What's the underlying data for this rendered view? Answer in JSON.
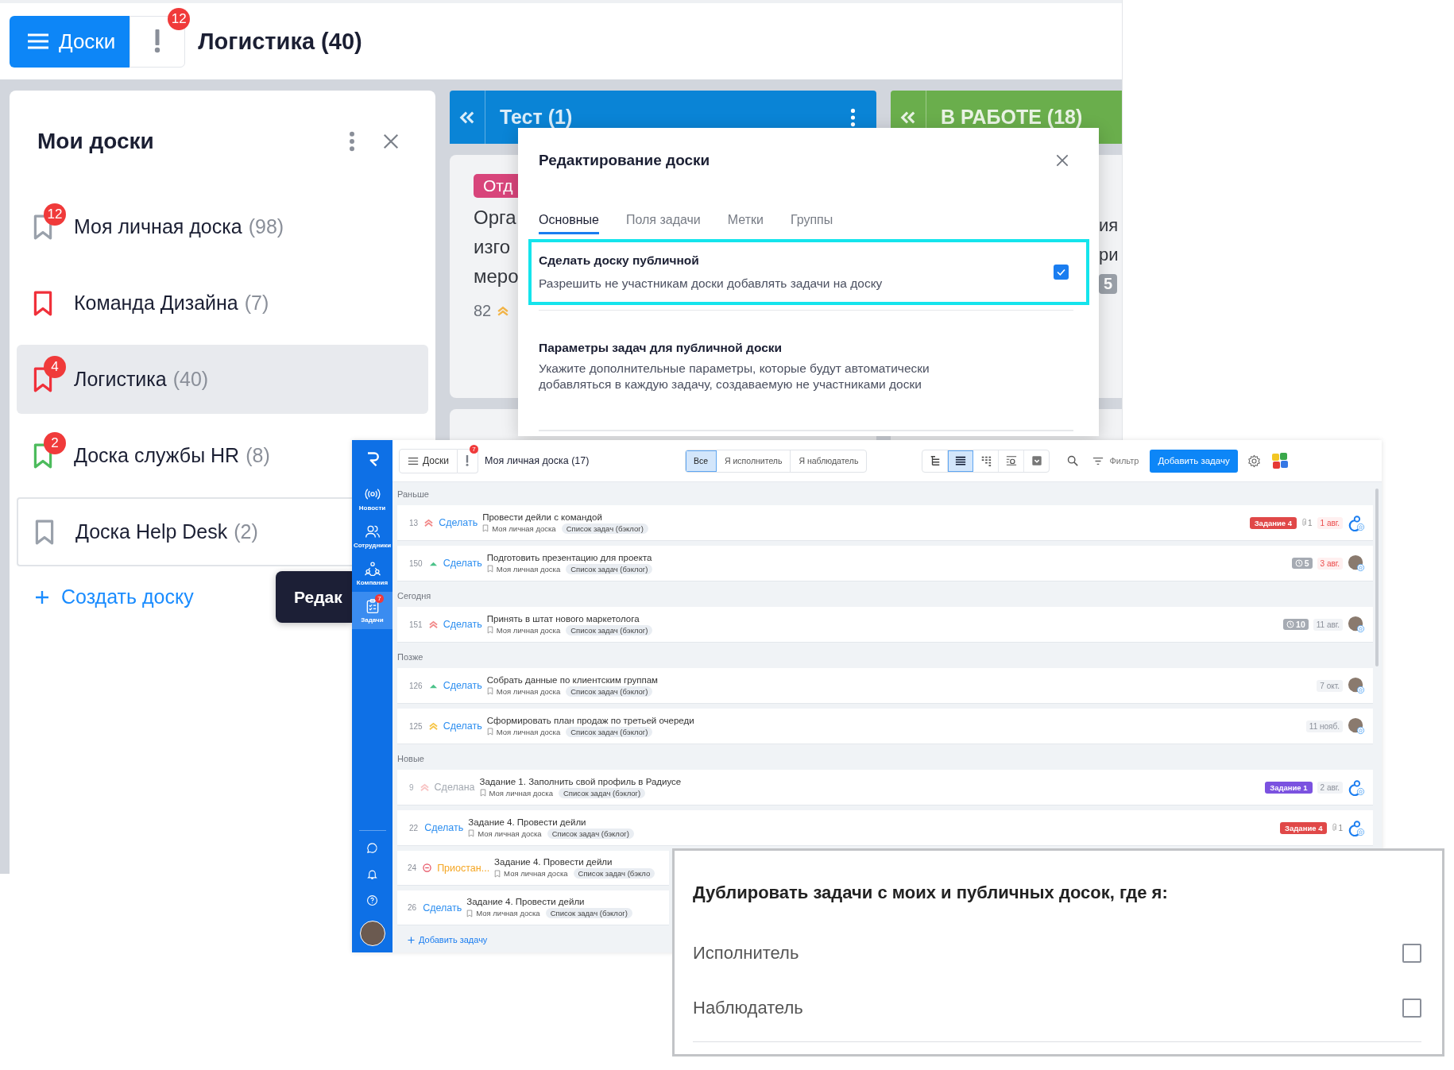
{
  "boards_app": {
    "menu_button": "Доски",
    "alerts_badge": "12",
    "title": "Логистика (40)",
    "sidebar": {
      "title": "Мои доски",
      "items": [
        {
          "name": "Моя личная доска",
          "count": "(98)",
          "color": "#9aa1ab",
          "badge": "12",
          "selected": false,
          "hovered": false
        },
        {
          "name": "Команда Дизайна",
          "count": "(7)",
          "color": "#f0303a",
          "selected": false,
          "hovered": false
        },
        {
          "name": "Логистика",
          "count": "(40)",
          "color": "#f0303a",
          "badge": "4",
          "selected": true,
          "hovered": false
        },
        {
          "name": "Доска службы HR",
          "count": "(8)",
          "color": "#4cbb5c",
          "badge": "2",
          "selected": false,
          "hovered": false
        },
        {
          "name": "Доска Help Desk",
          "count": "(2)",
          "color": "#9aa1ab",
          "selected": false,
          "hovered": true
        }
      ],
      "create_link": "Создать доску"
    },
    "tooltip": "Редак",
    "columns": [
      {
        "title": "Тест (1)",
        "color": "#0a84d6",
        "card": {
          "tag": "Отд",
          "lines": [
            "Орга",
            "изго",
            "меро"
          ],
          "number": "82"
        }
      },
      {
        "title": "В РАБОТЕ (18)",
        "color": "#6aae4c",
        "card": {
          "lines": [
            "ия",
            "ри"
          ],
          "timer": "5"
        }
      }
    ]
  },
  "edit_board_dialog": {
    "title": "Редактирование доски",
    "tabs": [
      {
        "label": "Основные",
        "selected": true
      },
      {
        "label": "Поля задачи",
        "selected": false
      },
      {
        "label": "Метки",
        "selected": false
      },
      {
        "label": "Группы",
        "selected": false
      }
    ],
    "public_setting": {
      "title": "Сделать доску публичной",
      "description": "Разрешить не участникам доски добавлять задачи на доску",
      "checked": true
    },
    "params": {
      "title": "Параметры задач для публичной доски",
      "description": "Укажите дополнительные параметры, которые будут автоматически добавляться в каждую задачу, создаваемую не участниками доски"
    }
  },
  "tasks_app": {
    "nav": [
      {
        "label": "Новости",
        "kind": "news",
        "selected": false
      },
      {
        "label": "Сотрудники",
        "kind": "people",
        "selected": false
      },
      {
        "label": "Компания",
        "kind": "company",
        "selected": false
      },
      {
        "label": "Задачи",
        "kind": "tasks",
        "selected": true,
        "badge": "7"
      }
    ],
    "menu_button": "Доски",
    "alerts_badge": "7",
    "title": "Моя личная доска (17)",
    "filter_tabs": [
      {
        "label": "Все",
        "selected": true
      },
      {
        "label": "Я исполнитель",
        "selected": false
      },
      {
        "label": "Я наблюдатель",
        "selected": false
      }
    ],
    "views": [
      {
        "kind": "tree",
        "selected": false
      },
      {
        "kind": "list",
        "selected": true
      },
      {
        "kind": "grid",
        "selected": false
      },
      {
        "kind": "timeline",
        "selected": false
      },
      {
        "kind": "archive",
        "selected": false
      }
    ],
    "filter_label": "Фильтр",
    "add_button": "Добавить задачу",
    "sections": [
      {
        "title": "Раньше",
        "tasks": [
          {
            "number": "13",
            "priority": {
              "kind": "high"
            },
            "status": {
              "kind": "todo",
              "label": "Сделать"
            },
            "title": "Провести дейли с командой",
            "board": "Моя личная доска",
            "list": "Список задач (бэклог)",
            "tag": {
              "label": "Задание 4",
              "color": "#e04848"
            },
            "attachments": "1",
            "date": {
              "label": "1 авг.",
              "overdue": true
            },
            "assignee": {
              "kind": "group"
            }
          },
          {
            "number": "150",
            "priority": {
              "kind": "low"
            },
            "status": {
              "kind": "todo",
              "label": "Сделать"
            },
            "title": "Подготовить презентацию для проекта",
            "board": "Моя личная доска",
            "list": "Список задач (бэклог)",
            "timer": "5",
            "date": {
              "label": "3 авг.",
              "overdue": true
            },
            "assignee": {
              "kind": "photo"
            }
          }
        ]
      },
      {
        "title": "Сегодня",
        "tasks": [
          {
            "number": "151",
            "priority": {
              "kind": "high"
            },
            "status": {
              "kind": "todo",
              "label": "Сделать"
            },
            "title": "Принять в штат нового маркетолога",
            "board": "Моя личная доска",
            "list": "Список задач (бэклог)",
            "timer": "10",
            "date": {
              "label": "11 авг.",
              "overdue": false
            },
            "assignee": {
              "kind": "photo"
            }
          }
        ]
      },
      {
        "title": "Позже",
        "tasks": [
          {
            "number": "126",
            "priority": {
              "kind": "low"
            },
            "status": {
              "kind": "todo",
              "label": "Сделать"
            },
            "title": "Собрать данные по клиентским группам",
            "board": "Моя личная доска",
            "list": "Список задач (бэклог)",
            "date": {
              "label": "7 окт.",
              "overdue": false
            },
            "assignee": {
              "kind": "photo"
            }
          },
          {
            "number": "125",
            "priority": {
              "kind": "medium"
            },
            "status": {
              "kind": "todo",
              "label": "Сделать"
            },
            "title": "Сформировать план продаж по третьей очереди",
            "board": "Моя личная доска",
            "list": "Список задач (бэклог)",
            "date": {
              "label": "11 нояб.",
              "overdue": false
            },
            "assignee": {
              "kind": "photo"
            }
          }
        ]
      },
      {
        "title": "Новые",
        "tasks": [
          {
            "number": "9",
            "priority": {
              "kind": "high"
            },
            "status": {
              "kind": "done",
              "label": "Сделана"
            },
            "title": "Задание 1. Заполнить свой профиль в Радиусе",
            "board": "Моя личная доска",
            "list": "Список задач (бэклог)",
            "tag": {
              "label": "Задание 1",
              "color": "#7b52e0"
            },
            "date": {
              "label": "2 авг.",
              "overdue": false
            },
            "assignee": {
              "kind": "group"
            }
          },
          {
            "number": "22",
            "status": {
              "kind": "todo",
              "label": "Сделать"
            },
            "title": "Задание 4. Провести дейли",
            "board": "Моя личная доска",
            "list": "Список задач (бэклог)",
            "tag": {
              "label": "Задание 4",
              "color": "#e04848"
            },
            "attachments": "1",
            "assignee": {
              "kind": "group"
            }
          },
          {
            "number": "24",
            "status": {
              "kind": "paused",
              "label": "Приостан..."
            },
            "title": "Задание 4. Провести дейли",
            "board": "Моя личная доска",
            "list": "Список задач (бэкло"
          },
          {
            "number": "26",
            "status": {
              "kind": "todo",
              "label": "Сделать"
            },
            "title": "Задание 4. Провести дейли",
            "board": "Моя личная доска",
            "list": "Список задач (бэклог)"
          }
        ]
      }
    ],
    "add_task": "Добавить задачу"
  },
  "duplicate_settings": {
    "title": "Дублировать задачи с моих и публичных досок, где я:",
    "options": [
      {
        "label": "Исполнитель",
        "checked": false
      },
      {
        "label": "Наблюдатель",
        "checked": false
      }
    ]
  }
}
